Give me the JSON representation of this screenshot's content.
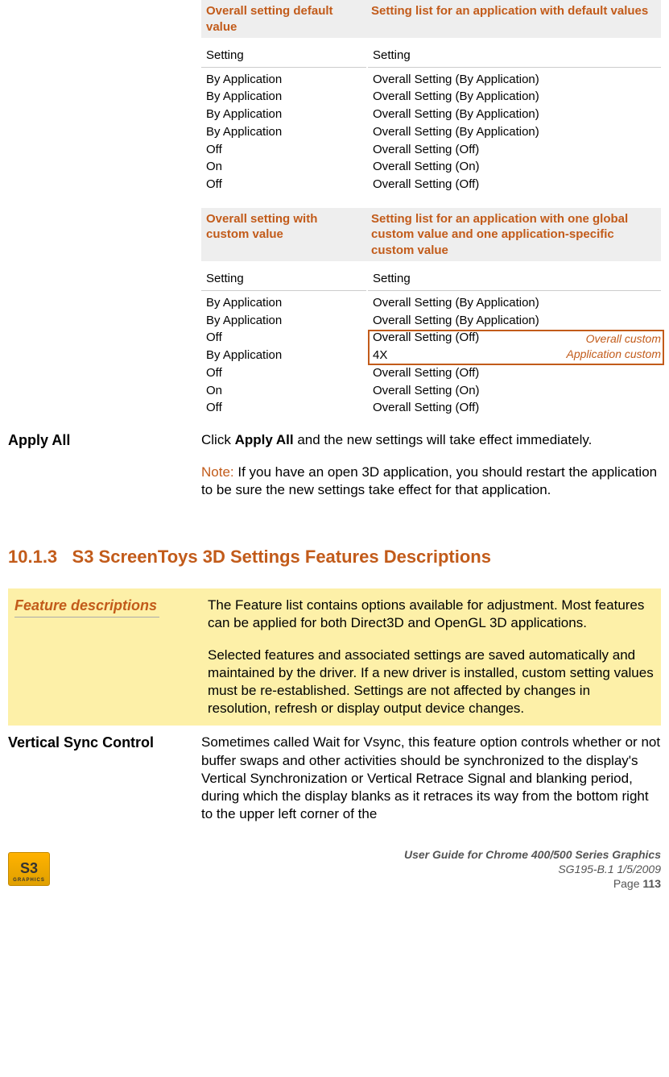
{
  "table1": {
    "hdr_left_1": "Overall setting default value",
    "hdr_right_1": "Setting list for an application with default values",
    "setting_word": "Setting",
    "left_list_1": [
      "By Application",
      "By Application",
      "By Application",
      "By Application",
      "Off",
      "On",
      "Off"
    ],
    "right_list_1": [
      "Overall Setting (By Application)",
      "Overall Setting (By Application)",
      "Overall Setting (By Application)",
      "Overall Setting (By Application)",
      "Overall Setting (Off)",
      "Overall Setting (On)",
      "Overall Setting (Off)"
    ],
    "hdr_left_2": "Overall setting with custom value",
    "hdr_right_2": "Setting list for an application with one global custom value and one application-specific custom value",
    "left_list_2": [
      "By Application",
      "By Application",
      "Off",
      "By Application",
      "Off",
      "On",
      "Off"
    ],
    "right_list_2": [
      "Overall Setting (By Application)",
      "Overall Setting (By Application)",
      "Overall Setting (Off)",
      "4X",
      "Overall Setting (Off)",
      "Overall Setting (On)",
      "Overall Setting (Off)"
    ],
    "callout1": "Overall custom",
    "callout2": "Application custom"
  },
  "apply_all": {
    "label": "Apply All",
    "body_pre": "Click ",
    "body_bold": "Apply All",
    "body_post": " and the new settings will take effect immediately.",
    "note_label": "Note:",
    "note_body": " If you have an open 3D application, you should restart the application to be sure the new settings take effect for that application."
  },
  "section": {
    "num": "10.1.3",
    "title": "S3 ScreenToys 3D Settings Features Descriptions"
  },
  "feat_desc": {
    "label": "Feature descriptions",
    "p1": "The Feature list contains options available for adjustment. Most features can be applied for both Direct3D and OpenGL 3D applications.",
    "p2": "Selected features and associated settings are saved automatically and maintained by the driver. If a new driver is installed, custom setting values must be re-established. Settings are not affected by changes in resolution, refresh or display output device changes."
  },
  "vsync": {
    "label": "Vertical Sync Control",
    "body": "Sometimes called Wait for Vsync, this feature option controls whether or not buffer swaps and other activities should be synchronized to the display's Vertical Synchronization or Vertical Retrace Signal and blanking period, during which the display blanks as it retraces its way from the bottom right to the upper left corner of the"
  },
  "footer": {
    "logo_main": "S3",
    "logo_sub": "GRAPHICS",
    "line1": "User Guide for Chrome 400/500 Series Graphics",
    "line2": "SG195-B.1   1/5/2009",
    "page_label": "Page ",
    "page_num": "113"
  }
}
